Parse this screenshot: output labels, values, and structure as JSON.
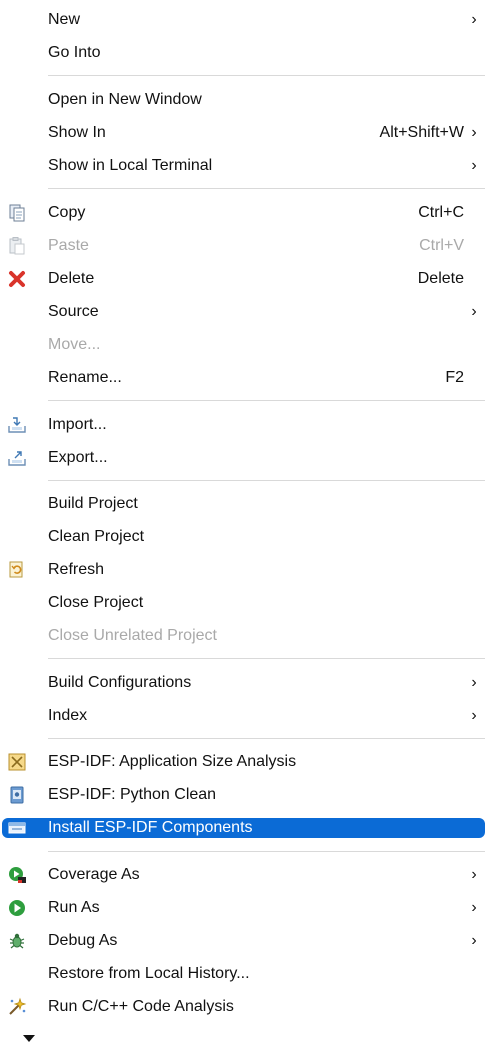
{
  "menu": {
    "new": {
      "label": "New",
      "submenu": "›"
    },
    "go_into": {
      "label": "Go Into"
    },
    "open_new_window": {
      "label": "Open in New Window"
    },
    "show_in": {
      "label": "Show In",
      "shortcut": "Alt+Shift+W",
      "submenu": "›"
    },
    "show_in_terminal": {
      "label": "Show in Local Terminal",
      "submenu": "›"
    },
    "copy": {
      "label": "Copy",
      "shortcut": "Ctrl+C",
      "icon": "copy-icon"
    },
    "paste": {
      "label": "Paste",
      "shortcut": "Ctrl+V",
      "icon": "paste-icon"
    },
    "delete": {
      "label": "Delete",
      "shortcut": "Delete",
      "icon": "delete-icon"
    },
    "source": {
      "label": "Source",
      "submenu": "›"
    },
    "move": {
      "label": "Move..."
    },
    "rename": {
      "label": "Rename...",
      "shortcut": "F2"
    },
    "import": {
      "label": "Import...",
      "icon": "import-icon"
    },
    "export": {
      "label": "Export...",
      "icon": "export-icon"
    },
    "build_project": {
      "label": "Build Project"
    },
    "clean_project": {
      "label": "Clean Project"
    },
    "refresh": {
      "label": "Refresh",
      "icon": "refresh-icon"
    },
    "close_project": {
      "label": "Close Project"
    },
    "close_unrelated": {
      "label": "Close Unrelated Project"
    },
    "build_configurations": {
      "label": "Build Configurations",
      "submenu": "›"
    },
    "index": {
      "label": "Index",
      "submenu": "›"
    },
    "esp_size": {
      "label": "ESP-IDF: Application Size Analysis",
      "icon": "size-analysis-icon"
    },
    "esp_python_clean": {
      "label": "ESP-IDF: Python Clean",
      "icon": "python-clean-icon"
    },
    "install_components": {
      "label": "Install ESP-IDF Components",
      "icon": "components-icon"
    },
    "coverage_as": {
      "label": "Coverage As",
      "submenu": "›",
      "icon": "coverage-icon"
    },
    "run_as": {
      "label": "Run As",
      "submenu": "›",
      "icon": "run-icon"
    },
    "debug_as": {
      "label": "Debug As",
      "submenu": "›",
      "icon": "debug-icon"
    },
    "restore_history": {
      "label": "Restore from Local History..."
    },
    "code_analysis": {
      "label": "Run C/C++ Code Analysis",
      "icon": "code-analysis-icon"
    }
  },
  "colors": {
    "highlight": "#0b6bd6",
    "disabled_text": "#a9a9a9",
    "separator": "#d9d9d9",
    "delete_red": "#d9342b",
    "run_green": "#2e9e3e"
  }
}
